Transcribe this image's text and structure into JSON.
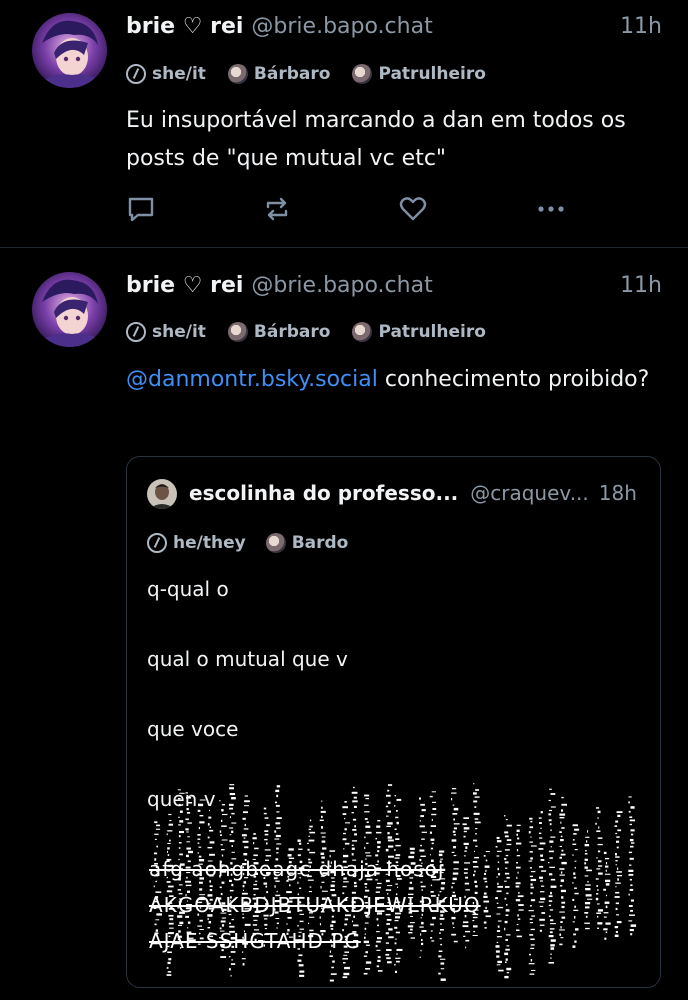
{
  "posts": [
    {
      "author": {
        "name": "brie ♡ rei",
        "handle": "@brie.bapo.chat"
      },
      "time": "11h",
      "labels": [
        "she/it",
        "Bárbaro",
        "Patrulheiro"
      ],
      "text": "Eu insuportável marcando a dan em todos os posts de \"que mutual vc etc\""
    },
    {
      "author": {
        "name": "brie ♡ rei",
        "handle": "@brie.bapo.chat"
      },
      "time": "11h",
      "labels": [
        "she/it",
        "Bárbaro",
        "Patrulheiro"
      ],
      "mention": "@danmontr.bsky.social",
      "text": " conhecimento proibido?",
      "quote": {
        "author": {
          "name": "escolinha do professo...",
          "handle": "@craquev..."
        },
        "time": "18h",
        "labels": [
          "he/they",
          "Bardo"
        ],
        "lines": [
          "q-qual o",
          "qual o mutual que v",
          "que voce",
          "quen v"
        ],
        "glitch_lines": [
          "afg aohgbeagc dhaja hosoj",
          "AKGOAKBDJBTUAKDJEWLRKUQ",
          "AJAE SSHGTAHD PG"
        ]
      }
    }
  ],
  "colors": {
    "background": "#000000",
    "text": "#f1f3f5",
    "muted": "#8b98a5",
    "link": "#3f8ff5",
    "border": "#1e2530"
  },
  "icons": [
    "reply-icon",
    "repost-icon",
    "like-icon",
    "more-icon"
  ]
}
